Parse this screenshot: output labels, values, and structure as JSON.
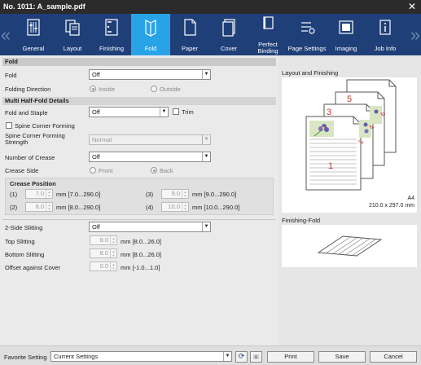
{
  "window": {
    "title": "No. 1011: A_sample.pdf"
  },
  "tabs": [
    {
      "label": "General",
      "icon": "general-icon"
    },
    {
      "label": "Layout",
      "icon": "layout-icon"
    },
    {
      "label": "Finishing",
      "icon": "finishing-icon"
    },
    {
      "label": "Fold",
      "icon": "fold-icon",
      "active": true
    },
    {
      "label": "Paper",
      "icon": "paper-icon"
    },
    {
      "label": "Cover",
      "icon": "cover-icon"
    },
    {
      "label": "Perfect Binding",
      "icon": "perfect-binding-icon"
    },
    {
      "label": "Page Settings",
      "icon": "page-settings-icon"
    },
    {
      "label": "Imaging",
      "icon": "imaging-icon"
    },
    {
      "label": "Job Info",
      "icon": "job-info-icon"
    }
  ],
  "fold": {
    "section": "Fold",
    "fold_label": "Fold",
    "fold_value": "Off",
    "direction_label": "Folding Direction",
    "inside": "Inside",
    "outside": "Outside",
    "multi_title": "Multi Half-Fold Details",
    "fold_staple_label": "Fold and Staple",
    "fold_staple_value": "Off",
    "trim": "Trim",
    "spine_forming": "Spine Corner Forming",
    "spine_strength_label": "Spine Corner Forming Strength",
    "spine_strength_value": "Normal",
    "crease_num_label": "Number of Crease",
    "crease_num_value": "Off",
    "crease_side_label": "Crease Side",
    "front": "Front",
    "back": "Back",
    "crease_pos_title": "Crease Position",
    "creases": [
      {
        "idx": "(1)",
        "value": "7.0",
        "range": "mm [7.0...290.0]"
      },
      {
        "idx": "(2)",
        "value": "8.0",
        "range": "mm [8.0...290.0]"
      },
      {
        "idx": "(3)",
        "value": "9.0",
        "range": "mm [9.0...290.0]"
      },
      {
        "idx": "(4)",
        "value": "10.0",
        "range": "mm [10.0...290.0]"
      }
    ],
    "slit_label": "2-Side Slitting",
    "slit_value": "Off",
    "top_label": "Top Slitting",
    "top_value": "8.0",
    "top_range": "mm [8.0...26.0]",
    "bottom_label": "Bottom Slitting",
    "bottom_value": "8.0",
    "bottom_range": "mm [8.0...26.0]",
    "offset_label": "Offset against Cover",
    "offset_value": "0.0",
    "offset_range": "mm [-1.0...1.0]"
  },
  "preview": {
    "layout_title": "Layout and Finishing",
    "paper": "A4",
    "size": "210.0 x 297.0 mm",
    "fold_title": "Finishing-Fold",
    "page_numbers": [
      "1",
      "2",
      "3",
      "4",
      "5",
      "6"
    ]
  },
  "footer": {
    "favorite_label": "Favorite Setting",
    "favorite_value": "Current Settings",
    "print": "Print",
    "save": "Save",
    "cancel": "Cancel"
  },
  "colors": {
    "tabbar": "#1f3f78",
    "active_tab": "#29a3e8",
    "titlebar": "#2b2b2b",
    "page_number": "#c0392b"
  }
}
